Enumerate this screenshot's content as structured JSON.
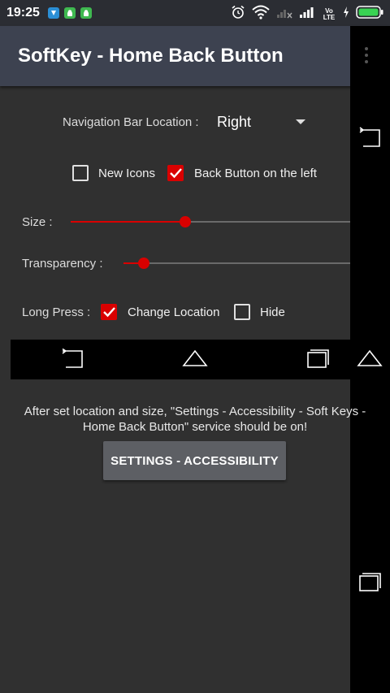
{
  "status_bar": {
    "time": "19:25",
    "network_label": "Vo LTE",
    "icons": [
      "app-notification-icon",
      "android-icon",
      "android-icon",
      "alarm-icon",
      "wifi-icon",
      "signal-icon",
      "signal-icon",
      "battery-charging-icon"
    ],
    "battery_color": "#39d353"
  },
  "toolbar": {
    "title": "SoftKey - Home Back Button"
  },
  "nav_location": {
    "label": "Navigation Bar Location :",
    "value": "Right"
  },
  "options": {
    "new_icons": {
      "label": "New Icons",
      "checked": false
    },
    "back_left": {
      "label": "Back Button on the left",
      "checked": true
    }
  },
  "size": {
    "label": "Size :",
    "value_percent": 41
  },
  "transparency": {
    "label": "Transparency :",
    "value_percent": 9
  },
  "long_press": {
    "label": "Long Press :",
    "change_location": {
      "label": "Change Location",
      "checked": true
    },
    "hide": {
      "label": "Hide",
      "checked": false
    }
  },
  "info": {
    "line1": "After set location and size, \"Settings - Accessibility - Soft Keys -",
    "line2": "Home Back Button\" service should be on!"
  },
  "settings_button": {
    "label": "SETTINGS - ACCESSIBILITY"
  },
  "colors": {
    "accent": "#d90000",
    "toolbar": "#3d4250",
    "background": "#303030",
    "button": "#5d5f64"
  }
}
